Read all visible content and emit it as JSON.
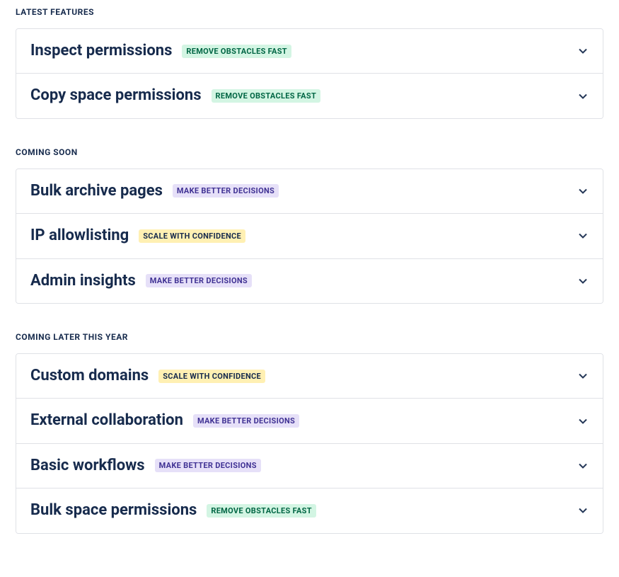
{
  "badges": {
    "remove_obstacles": {
      "label": "REMOVE OBSTACLES FAST",
      "variant": "green"
    },
    "better_decisions": {
      "label": "MAKE BETTER DECISIONS",
      "variant": "purple"
    },
    "scale_confidence": {
      "label": "SCALE WITH CONFIDENCE",
      "variant": "yellow"
    }
  },
  "sections": {
    "latest": {
      "heading": "LATEST FEATURES",
      "items": [
        {
          "title": "Inspect permissions",
          "badge": "remove_obstacles"
        },
        {
          "title": "Copy space permissions",
          "badge": "remove_obstacles"
        }
      ]
    },
    "coming_soon": {
      "heading": "COMING SOON",
      "items": [
        {
          "title": "Bulk archive pages",
          "badge": "better_decisions"
        },
        {
          "title": "IP allowlisting",
          "badge": "scale_confidence"
        },
        {
          "title": "Admin insights",
          "badge": "better_decisions"
        }
      ]
    },
    "coming_later": {
      "heading": "COMING LATER THIS YEAR",
      "items": [
        {
          "title": "Custom domains",
          "badge": "scale_confidence"
        },
        {
          "title": "External collaboration",
          "badge": "better_decisions"
        },
        {
          "title": "Basic workflows",
          "badge": "better_decisions"
        },
        {
          "title": "Bulk space permissions",
          "badge": "remove_obstacles"
        }
      ]
    }
  }
}
